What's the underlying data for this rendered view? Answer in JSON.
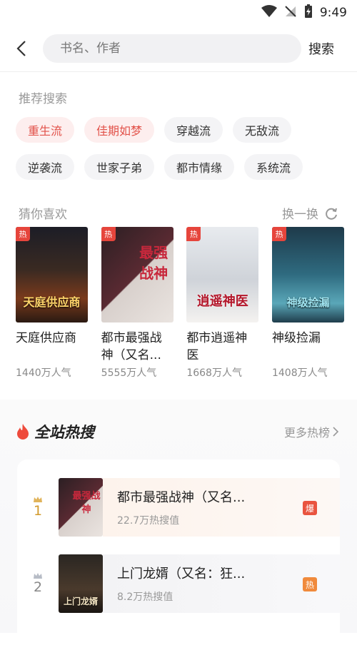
{
  "status_bar": {
    "time": "9:49"
  },
  "search": {
    "placeholder": "书名、作者",
    "button_label": "搜索"
  },
  "recommend": {
    "title": "推荐搜索",
    "tags": [
      {
        "label": "重生流",
        "hot": true
      },
      {
        "label": "佳期如梦",
        "hot": true
      },
      {
        "label": "穿越流",
        "hot": false
      },
      {
        "label": "无敌流",
        "hot": false
      },
      {
        "label": "逆袭流",
        "hot": false
      },
      {
        "label": "世家子弟",
        "hot": false
      },
      {
        "label": "都市情缘",
        "hot": false
      },
      {
        "label": "系统流",
        "hot": false
      }
    ]
  },
  "guess": {
    "title": "猜你喜欢",
    "refresh_label": "换一换",
    "books": [
      {
        "badge": "热",
        "cover_text": "天庭供应商",
        "name": "天庭供应商",
        "popularity": "1440万人气"
      },
      {
        "badge": "热",
        "cover_text": "最强战神",
        "name": "都市最强战神（又名...",
        "popularity": "5555万人气"
      },
      {
        "badge": "热",
        "cover_text": "逍遥神医",
        "name": "都市逍遥神医",
        "popularity": "1668万人气"
      },
      {
        "badge": "热",
        "cover_text": "神级捡漏",
        "name": "神级捡漏",
        "popularity": "1408万人气"
      }
    ]
  },
  "hot_search": {
    "title": "全站热搜",
    "more_label": "更多热榜",
    "items": [
      {
        "rank": "1",
        "name": "都市最强战神（又名...",
        "heat": "22.7万热搜值",
        "badge": "爆",
        "badge_color": "#e9543f",
        "cover_text": "最强战神"
      },
      {
        "rank": "2",
        "name": "上门龙婿（又名：狂...",
        "heat": "8.2万热搜值",
        "badge": "热",
        "badge_color": "#f08a3c",
        "cover_text": "上门龙婿"
      }
    ]
  },
  "colors": {
    "accent": "#e2524a",
    "hot_tag_bg": "#fdeeee",
    "badge_red": "#e6453c"
  }
}
